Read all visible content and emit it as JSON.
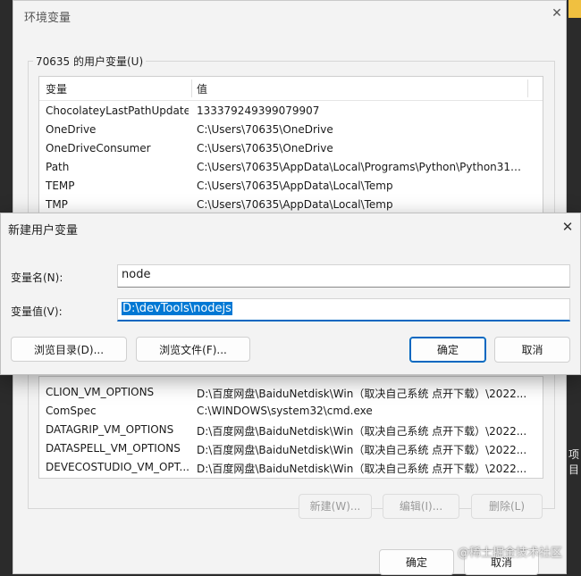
{
  "env_dialog": {
    "title": "环境变量",
    "close_glyph": "✕",
    "user_group_label": "70635 的用户变量(U)",
    "columns": {
      "name": "变量",
      "value": "值"
    },
    "user_vars": [
      {
        "name": "ChocolateyLastPathUpdate",
        "value": "133379249399079907"
      },
      {
        "name": "OneDrive",
        "value": "C:\\Users\\70635\\OneDrive"
      },
      {
        "name": "OneDriveConsumer",
        "value": "C:\\Users\\70635\\OneDrive"
      },
      {
        "name": "Path",
        "value": "C:\\Users\\70635\\AppData\\Local\\Programs\\Python\\Python311\\..."
      },
      {
        "name": "TEMP",
        "value": "C:\\Users\\70635\\AppData\\Local\\Temp"
      },
      {
        "name": "TMP",
        "value": "C:\\Users\\70635\\AppData\\Local\\Temp"
      }
    ],
    "system_vars": [
      {
        "name": "CLION_VM_OPTIONS",
        "value": "D:\\百度网盘\\BaiduNetdisk\\Win（取决自己系统 点开下载）\\2022..."
      },
      {
        "name": "ComSpec",
        "value": "C:\\WINDOWS\\system32\\cmd.exe"
      },
      {
        "name": "DATAGRIP_VM_OPTIONS",
        "value": "D:\\百度网盘\\BaiduNetdisk\\Win（取决自己系统 点开下载）\\2022..."
      },
      {
        "name": "DATASPELL_VM_OPTIONS",
        "value": "D:\\百度网盘\\BaiduNetdisk\\Win（取决自己系统 点开下载）\\2022..."
      },
      {
        "name": "DEVECOSTUDIO_VM_OPT...",
        "value": "D:\\百度网盘\\BaiduNetdisk\\Win（取决自己系统 点开下载）\\2022..."
      }
    ],
    "system_buttons": {
      "new": "新建(W)...",
      "edit": "编辑(I)...",
      "delete": "删除(L)"
    },
    "ok": "确定",
    "cancel": "取消"
  },
  "new_var_dialog": {
    "title": "新建用户变量",
    "close_glyph": "✕",
    "name_label": "变量名(N):",
    "name_value": "node",
    "value_label": "变量值(V):",
    "value_value": "D:\\devTools\\nodejs",
    "browse_dir": "浏览目录(D)...",
    "browse_file": "浏览文件(F)...",
    "ok": "确定",
    "cancel": "取消"
  },
  "watermark": "@稀土掘金技术社区",
  "edge_text": "项目"
}
